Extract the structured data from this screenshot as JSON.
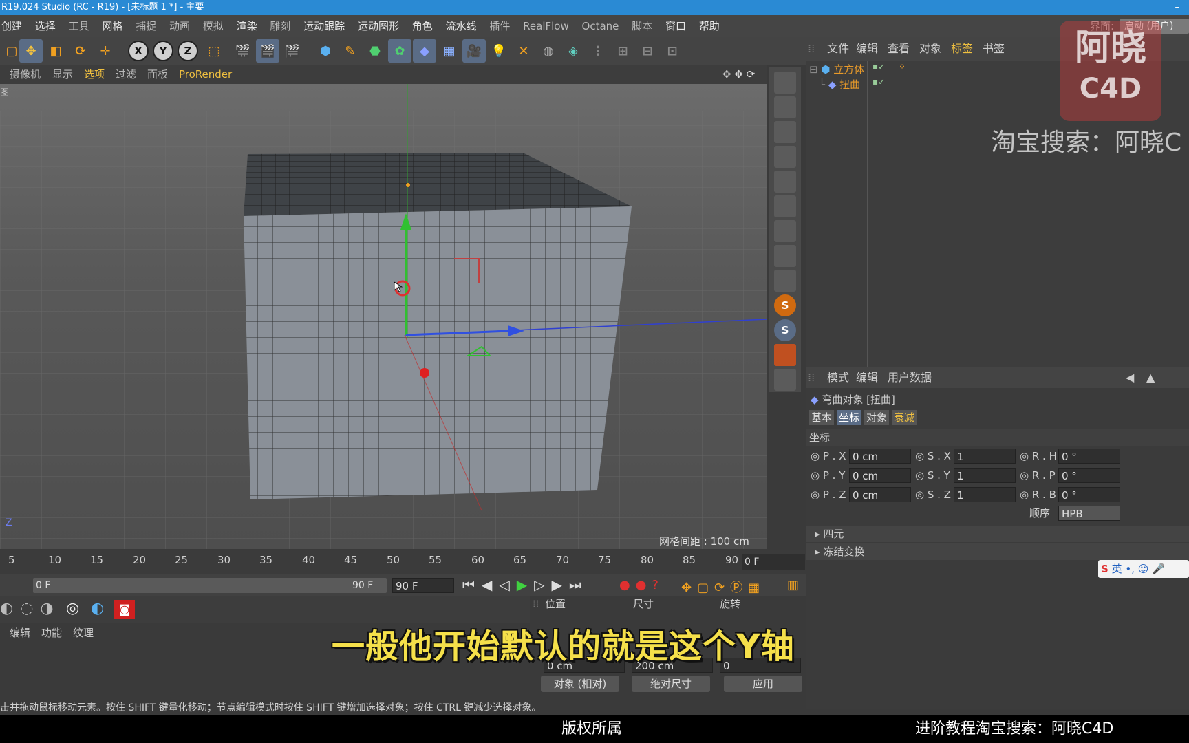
{
  "window": {
    "title": "R19.024 Studio (RC - R19) - [未标题 1 *] - 主要",
    "minimize": "–"
  },
  "menubar": {
    "items": [
      "创建",
      "选择",
      "工具",
      "网格",
      "捕捉",
      "动画",
      "模拟",
      "渲染",
      "雕刻",
      "运动跟踪",
      "运动图形",
      "角色",
      "流水线",
      "插件",
      "RealFlow",
      "Octane",
      "脚本",
      "窗口",
      "帮助"
    ],
    "interface_label": "界面:",
    "layout_value": "启动 (用户)"
  },
  "toolbar": {
    "x": "X",
    "y": "Y",
    "z": "Z"
  },
  "viewport": {
    "menu": [
      "摄像机",
      "显示",
      "选项",
      "过滤",
      "面板",
      "ProRender"
    ],
    "grid_spacing": "网格间距 : 100 cm",
    "axis_z": "Z",
    "label_partial": "图"
  },
  "object_manager": {
    "menu": [
      "文件",
      "编辑",
      "查看",
      "对象",
      "标签",
      "书签"
    ],
    "objects": [
      {
        "name": "立方体"
      },
      {
        "name": "扭曲"
      }
    ]
  },
  "attributes": {
    "menu": [
      "模式",
      "编辑",
      "用户数据"
    ],
    "object_title": "弯曲对象 [扭曲]",
    "tabs": [
      "基本",
      "坐标",
      "对象",
      "衰减"
    ],
    "section_title": "坐标",
    "fields": {
      "px_label": "P . X",
      "px": "0 cm",
      "py_label": "P . Y",
      "py": "0 cm",
      "pz_label": "P . Z",
      "pz": "0 cm",
      "sx_label": "S . X",
      "sx": "1",
      "sy_label": "S . Y",
      "sy": "1",
      "sz_label": "S . Z",
      "sz": "1",
      "rh_label": "R . H",
      "rh": "0 °",
      "rp_label": "R . P",
      "rp": "0 °",
      "rb_label": "R . B",
      "rb": "0 °",
      "order_label": "顺序",
      "order": "HPB"
    },
    "collapsed_sections": [
      "四元",
      "冻结变换"
    ]
  },
  "timeline": {
    "ticks": [
      "5",
      "10",
      "15",
      "20",
      "25",
      "30",
      "35",
      "40",
      "45",
      "50",
      "55",
      "60",
      "65",
      "70",
      "75",
      "80",
      "85",
      "90"
    ],
    "current_frame": "0 F",
    "range_start": "0 F",
    "range_end": "90 F",
    "end_frame": "90 F"
  },
  "material": {
    "menu": [
      "编辑",
      "功能",
      "纹理"
    ]
  },
  "coords": {
    "headers": [
      "位置",
      "尺寸",
      "旋转"
    ],
    "row_z_pos": "0 cm",
    "row_z_size": "200 cm",
    "row_z_rot": "0",
    "mode": "对象 (相对)",
    "size_mode": "绝对尺寸",
    "apply": "应用"
  },
  "status": {
    "text": "击并拖动鼠标移动元素。按住 SHIFT 键量化移动；节点编辑模式时按住 SHIFT 键增加选择对象；按住 CTRL 键减少选择对象。"
  },
  "overlay": {
    "subtitle": "一般他开始默认的就是这个Y轴",
    "bottom_center": "版权所属",
    "bottom_right": "进阶教程淘宝搜索：阿晓C4D",
    "watermark_top": "阿晓",
    "watermark_bottom": "C4D",
    "watermark_search": "淘宝搜索：阿晓C",
    "ime_text": "英"
  },
  "colors": {
    "title_bar": "#2a8ad4",
    "accent_orange": "#e89a2a",
    "subtitle_yellow": "#f5e04a"
  }
}
